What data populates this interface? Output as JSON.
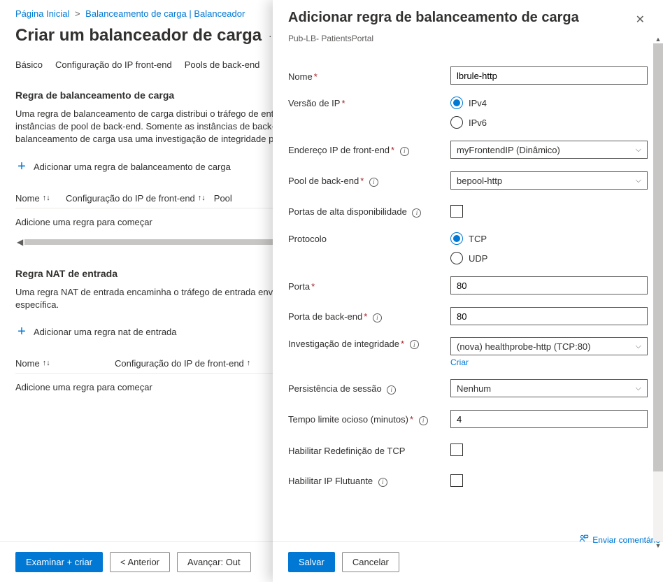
{
  "breadcrumb": {
    "home": "Página Inicial",
    "lb": "Balanceamento de carga | Balanceador"
  },
  "pageTitle": "Criar um balanceador de carga",
  "tabs": {
    "basic": "Básico",
    "feip": "Configuração do IP front-end",
    "bepools": "Pools de back-end"
  },
  "lbrule": {
    "title": "Regra de balanceamento de carga",
    "desc": "Uma regra de balanceamento de carga distribui o tráfego de entrada enviado a uma combinação de endereço IP e porta selecionada em um grupo de instâncias de pool de back-end. Somente as instâncias de back-end que a investigação de integridade considera íntegras recebem novo tráfego. A regra de balanceamento de carga usa uma investigação de integridade para determinar quais",
    "add": "Adicionar uma regra de balanceamento de carga",
    "colName": "Nome",
    "colFe": "Configuração do IP de front-end",
    "colPool": "Pool",
    "empty": "Adicione uma regra para começar"
  },
  "nat": {
    "title": "Regra NAT de entrada",
    "desc": "Uma regra NAT de entrada encaminha o tráfego de entrada enviado a uma combinação de endereço IP e porta selecionada para uma máquina virtual específica.",
    "add": "Adicionar uma regra nat de entrada",
    "colName": "Nome",
    "colFe": "Configuração do IP de front-end",
    "empty": "Adicione uma regra para começar"
  },
  "footer": {
    "review": "Examinar + criar",
    "prev": "<   Anterior",
    "next": "Avançar: Out"
  },
  "panel": {
    "title": "Adicionar regra de balanceamento de carga",
    "sub": "Pub-LB- PatientsPortal",
    "labels": {
      "name": "Nome",
      "ipver": "Versão de IP",
      "feip": "Endereço IP de front-end",
      "bepool": "Pool de back-end",
      "haports": "Portas de alta disponibilidade",
      "protocol": "Protocolo",
      "port": "Porta",
      "beport": "Porta de back-end",
      "probe": "Investigação de integridade",
      "persist": "Persistência de sessão",
      "idle": "Tempo limite ocioso (minutos)",
      "tcprst": "Habilitar Redefinição de TCP",
      "floatip": "Habilitar IP Flutuante"
    },
    "values": {
      "name": "lbrule-http",
      "ipv4": "IPv4",
      "ipv6": "IPv6",
      "feip": "myFrontendIP (Dinâmico)",
      "bepool": "bepool-http",
      "tcp": "TCP",
      "udp": "UDP",
      "port": "80",
      "beport": "80",
      "probe": "(nova) healthprobe-http (TCP:80)",
      "create": "Criar",
      "persist": "Nenhum",
      "idle": "4"
    },
    "save": "Salvar",
    "cancel": "Cancelar",
    "feedback": "Enviar comentário"
  }
}
